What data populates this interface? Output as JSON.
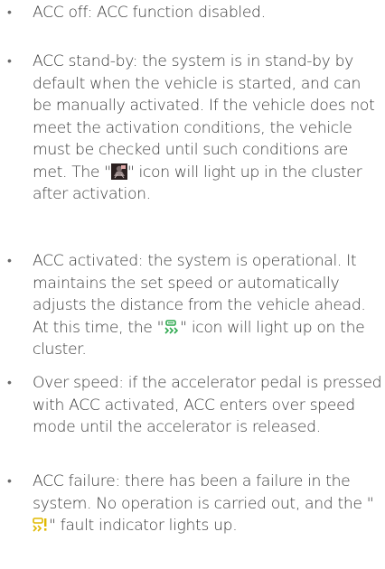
{
  "items": [
    {
      "text": "ACC off: ACC function disabled."
    },
    {
      "text_before": "ACC stand-by: the system is in stand-by by default when the vehicle is started, and can be manually activated. If the vehicle does not meet the activation conditions, the vehicle must be checked until such conditions are met. The \"",
      "icon": "acc-standby-icon",
      "text_after": "\" icon will light up in the cluster after activation."
    },
    {
      "text_before": "ACC activated: the system is operational. It maintains the set speed or automatically adjusts the distance from the vehicle ahead. At this time, the \"",
      "icon": "acc-activated-icon",
      "text_after": "\" icon will light up on the cluster."
    },
    {
      "text": "Over speed: if the accelerator pedal is pressed with ACC activated, ACC enters over speed mode until the accelerator is released."
    },
    {
      "text_before": "ACC failure: there has been a failure in the system. No operation is carried out, and the \"",
      "icon": "acc-fault-icon",
      "text_after": "\" fault indicator lights up."
    }
  ],
  "colors": {
    "text": "#3a3a3a",
    "standby_icon_bg": "#2a1f1f",
    "activated_icon": "#2fa84f",
    "fault_icon": "#e0b800"
  }
}
